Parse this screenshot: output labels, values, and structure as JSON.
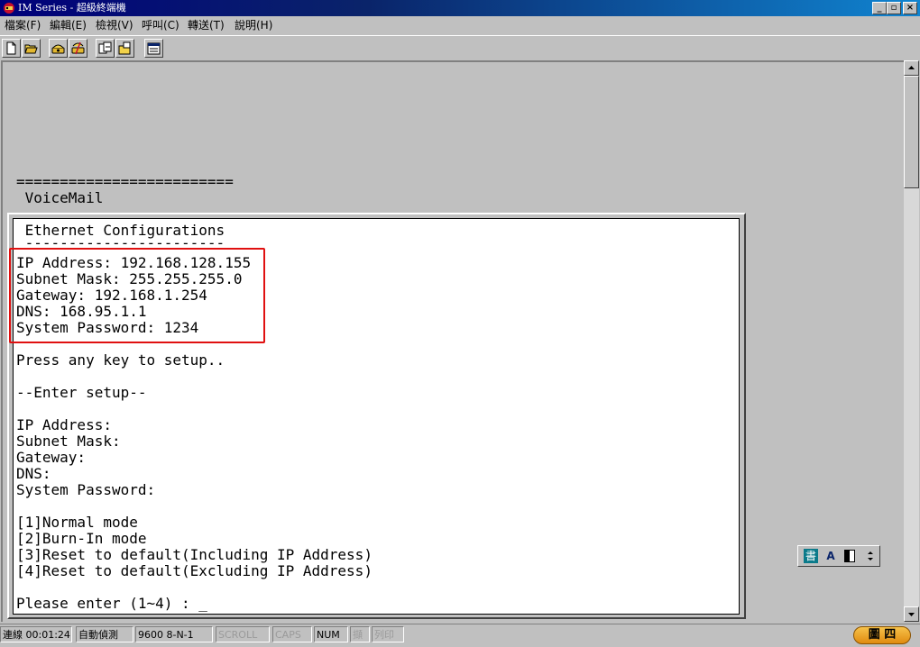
{
  "window": {
    "title": "IM Series - 超級終端機",
    "min_label": "_",
    "max_label": "▫",
    "close_label": "×"
  },
  "menu": [
    {
      "label": "檔案(F)"
    },
    {
      "label": "編輯(E)"
    },
    {
      "label": "檢視(V)"
    },
    {
      "label": "呼叫(C)"
    },
    {
      "label": "轉送(T)"
    },
    {
      "label": "說明(H)"
    }
  ],
  "toolbar": {
    "icons": [
      "new-icon",
      "open-icon",
      "call-icon",
      "disconnect-icon",
      "send-icon",
      "receive-icon",
      "properties-icon"
    ]
  },
  "terminal": {
    "separator": "=========================",
    "product": " VoiceMail",
    "dialog_title": " Ethernet Configurations",
    "dialog_underline": " -----------------------",
    "current": [
      "IP Address: 192.168.128.155",
      "Subnet Mask: 255.255.255.0",
      "Gateway: 192.168.1.254",
      "DNS: 168.95.1.1",
      "System Password: 1234"
    ],
    "press_key": "Press any key to setup..",
    "enter_setup": "--Enter setup--",
    "fields": [
      "IP Address:",
      "Subnet Mask:",
      "Gateway:",
      "DNS:",
      "System Password:"
    ],
    "modes": [
      "[1]Normal mode",
      "[2]Burn-In mode",
      "[3]Reset to default(Including IP Address)",
      "[4]Reset to default(Excluding IP Address)"
    ],
    "prompt": "Please enter (1~4) : _"
  },
  "ime": {
    "char1": "書",
    "char2": "A"
  },
  "status": {
    "connected_time": "連線 00:01:24",
    "auto_detect": "自動偵測",
    "port_settings": "9600 8-N-1",
    "scroll": "SCROLL",
    "caps": "CAPS",
    "num": "NUM",
    "capture": "擷",
    "print": "列印",
    "figure_label": "圖 四"
  },
  "colors": {
    "highlight": "#e01010",
    "titlebar": "#0a246a"
  }
}
